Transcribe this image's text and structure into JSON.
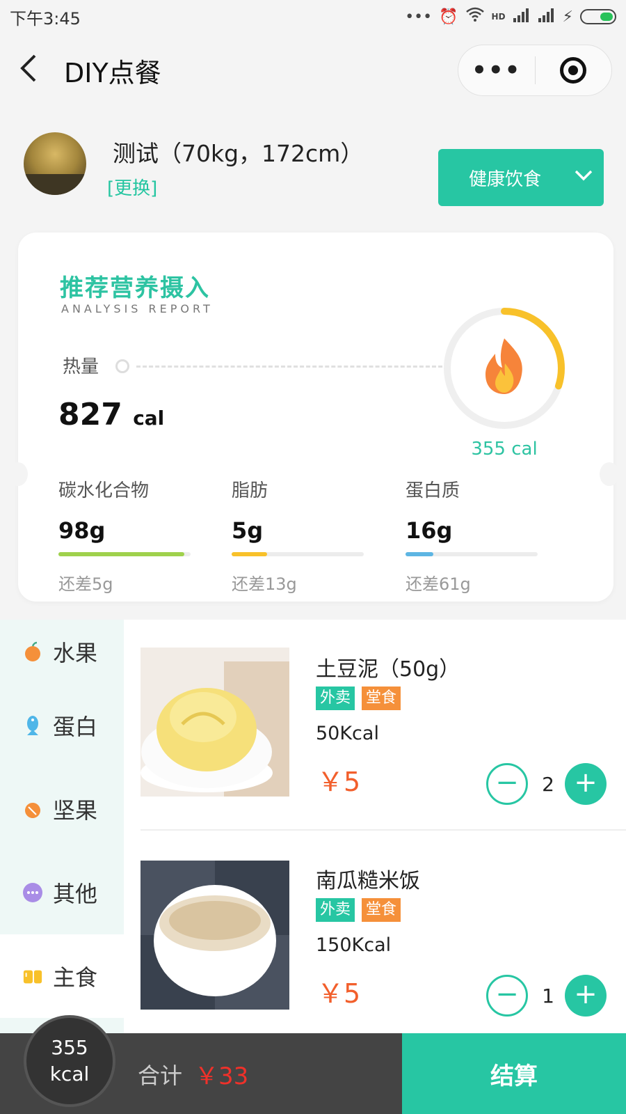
{
  "status_bar": {
    "time": "下午3:45",
    "dots": "•••",
    "hd": "HD"
  },
  "nav": {
    "back": "〈",
    "title": "DIY点餐",
    "more": "•••"
  },
  "profile": {
    "name": "测试（70kg，172cm）",
    "change": "[更换]"
  },
  "diet_selector": {
    "label": "健康饮食"
  },
  "nutrition": {
    "title": "推荐营养摄入",
    "subtitle": "ANALYSIS REPORT",
    "heat": {
      "label": "热量",
      "value": "827",
      "unit": "cal"
    },
    "ring": {
      "value": "355 cal",
      "progress": 0.3,
      "color": "#f8c12a"
    },
    "nutrients": [
      {
        "name": "碳水化合物",
        "value": "98g",
        "short": "还差5g",
        "progress": 0.95,
        "color": "#9fd14c"
      },
      {
        "name": "脂肪",
        "value": "5g",
        "short": "还差13g",
        "progress": 0.27,
        "color": "#f8c12a"
      },
      {
        "name": "蛋白质",
        "value": "16g",
        "short": "还差61g",
        "progress": 0.21,
        "color": "#5db5e3"
      }
    ]
  },
  "categories": [
    {
      "label": "水果",
      "icon": "apple-icon",
      "color": "#f5903a"
    },
    {
      "label": "蛋白",
      "icon": "fish-icon",
      "color": "#4fb6e8"
    },
    {
      "label": "坚果",
      "icon": "nut-icon",
      "color": "#f5903a"
    },
    {
      "label": "其他",
      "icon": "more-bubble-icon",
      "color": "#a98de6"
    },
    {
      "label": "主食",
      "icon": "bread-icon",
      "color": "#f8c12a",
      "active": true
    }
  ],
  "foods": [
    {
      "name": "土豆泥（50g）",
      "tags": [
        "外卖",
        "堂食"
      ],
      "kcal": "50Kcal",
      "price": "￥5",
      "qty": "2"
    },
    {
      "name": "南瓜糙米饭",
      "tags": [
        "外卖",
        "堂食"
      ],
      "kcal": "150Kcal",
      "price": "￥5",
      "qty": "1"
    }
  ],
  "bottom": {
    "kcal_value": "355",
    "kcal_unit": "kcal",
    "total_label": "合计",
    "total_value": "￥33",
    "checkout": "结算"
  },
  "colors": {
    "accent": "#27c6a3",
    "price": "#f25f2c",
    "total": "#f0312a"
  }
}
